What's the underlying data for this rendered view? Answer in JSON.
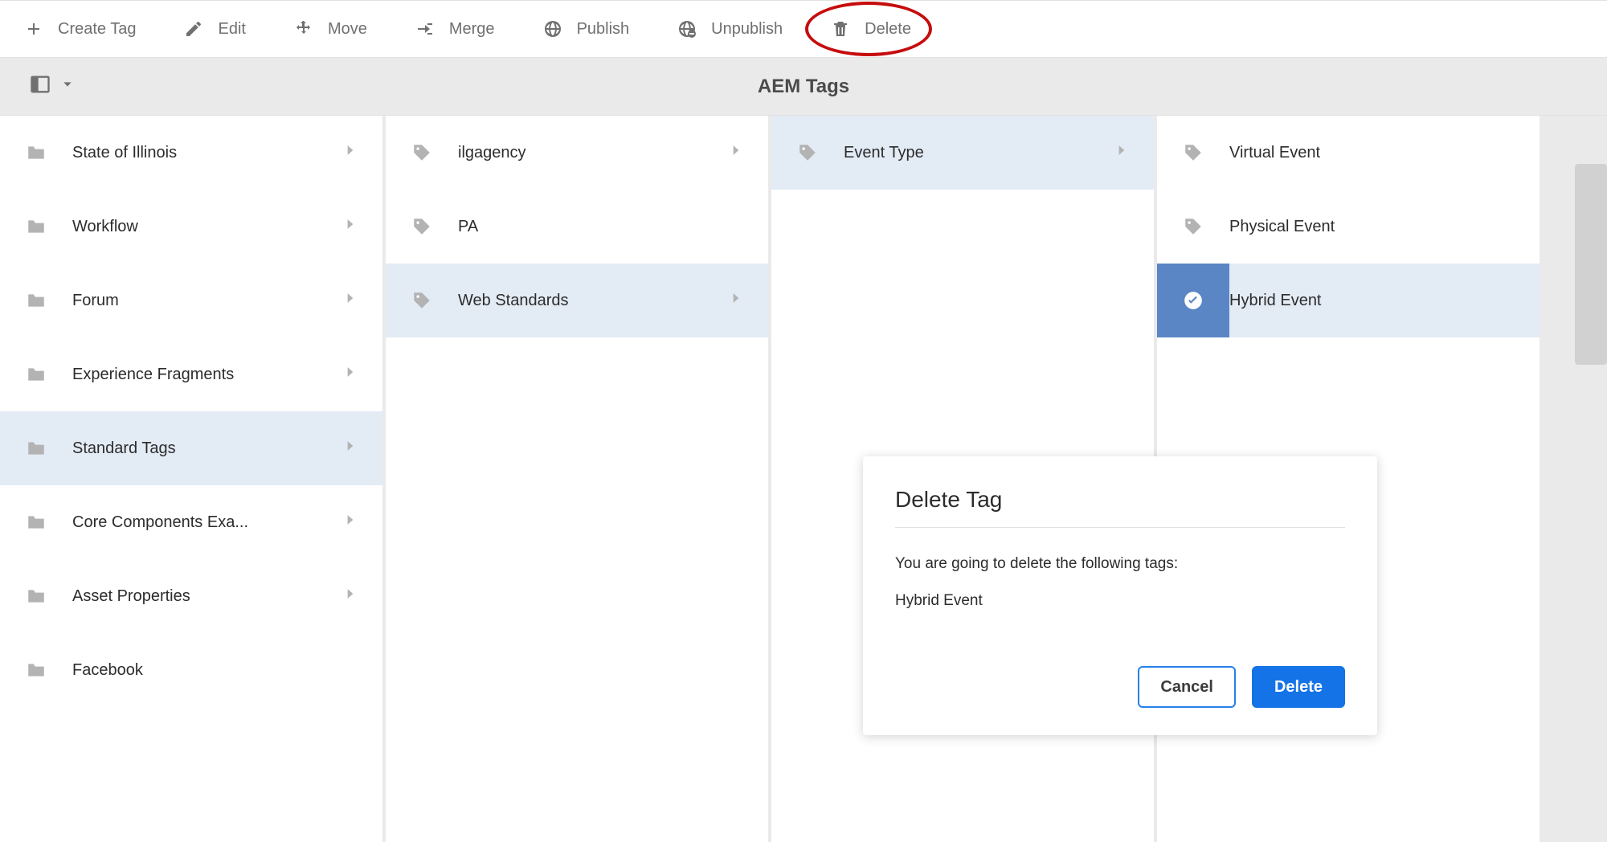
{
  "actions": {
    "create": "Create Tag",
    "edit": "Edit",
    "move": "Move",
    "merge": "Merge",
    "publish": "Publish",
    "unpublish": "Unpublish",
    "delete": "Delete"
  },
  "page": {
    "title": "AEM Tags"
  },
  "columns": [
    {
      "items": [
        {
          "icon": "folder",
          "label": "State of Illinois",
          "hasChildren": true,
          "selected": false
        },
        {
          "icon": "folder",
          "label": "Workflow",
          "hasChildren": true,
          "selected": false
        },
        {
          "icon": "folder",
          "label": "Forum",
          "hasChildren": true,
          "selected": false
        },
        {
          "icon": "folder",
          "label": "Experience Fragments",
          "hasChildren": true,
          "selected": false
        },
        {
          "icon": "folder",
          "label": "Standard Tags",
          "hasChildren": true,
          "selected": true
        },
        {
          "icon": "folder",
          "label": "Core Components Exa...",
          "hasChildren": true,
          "selected": false
        },
        {
          "icon": "folder",
          "label": "Asset Properties",
          "hasChildren": true,
          "selected": false
        },
        {
          "icon": "folder",
          "label": "Facebook",
          "hasChildren": false,
          "selected": false
        }
      ]
    },
    {
      "items": [
        {
          "icon": "tag",
          "label": "ilgagency",
          "hasChildren": true,
          "selected": false
        },
        {
          "icon": "tag",
          "label": "PA",
          "hasChildren": false,
          "selected": false
        },
        {
          "icon": "tag",
          "label": "Web Standards",
          "hasChildren": true,
          "selected": true
        }
      ]
    },
    {
      "items": [
        {
          "icon": "tag",
          "label": "Event Type",
          "hasChildren": true,
          "selected": true
        }
      ]
    },
    {
      "items": [
        {
          "icon": "tag",
          "label": "Virtual Event",
          "hasChildren": false,
          "selected": false
        },
        {
          "icon": "tag",
          "label": "Physical Event",
          "hasChildren": false,
          "selected": false
        },
        {
          "icon": "check",
          "label": "Hybrid Event",
          "hasChildren": false,
          "selected": true,
          "checked": true
        }
      ]
    }
  ],
  "dialog": {
    "title": "Delete Tag",
    "message": "You are going to delete the following tags:",
    "tag": "Hybrid Event",
    "cancel": "Cancel",
    "confirm": "Delete"
  }
}
